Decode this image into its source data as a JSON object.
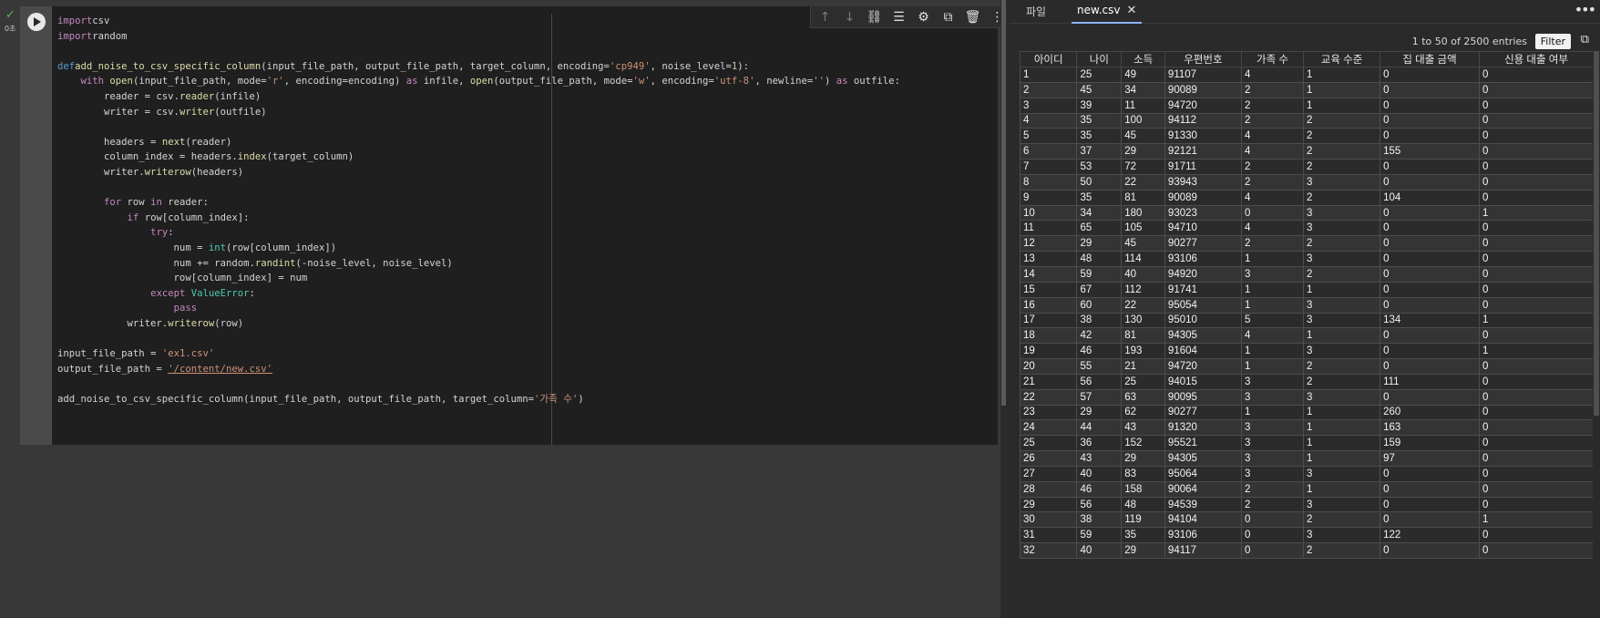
{
  "cell": {
    "exec_check": "✓",
    "exec_time": "0초",
    "code_lines": [
      [
        [
          "kw",
          "import"
        ],
        [
          "",
          "csv"
        ]
      ],
      [
        [
          "kw",
          "import"
        ],
        [
          "",
          "random"
        ]
      ],
      [],
      [
        [
          "df",
          "def"
        ],
        [
          "",
          ""
        ],
        [
          "fn",
          "add_noise_to_csv_specific_column"
        ],
        [
          "",
          "(input_file_path, output_file_path, target_column, encoding="
        ],
        [
          "st",
          "'cp949'"
        ],
        [
          "",
          ", noise_level="
        ],
        [
          "nm",
          "1"
        ],
        [
          "",
          "):"
        ]
      ],
      [
        [
          "",
          "    "
        ],
        [
          "kw",
          "with"
        ],
        [
          "",
          " "
        ],
        [
          "fn",
          "open"
        ],
        [
          "",
          "(input_file_path, mode="
        ],
        [
          "st",
          "'r'"
        ],
        [
          "",
          ", encoding=encoding) "
        ],
        [
          "kw",
          "as"
        ],
        [
          "",
          " infile, "
        ],
        [
          "fn",
          "open"
        ],
        [
          "",
          "(output_file_path, mode="
        ],
        [
          "st",
          "'w'"
        ],
        [
          "",
          ", encoding="
        ],
        [
          "st",
          "'utf-8'"
        ],
        [
          "",
          ", newline="
        ],
        [
          "st",
          "''"
        ],
        [
          "",
          ") "
        ],
        [
          "kw",
          "as"
        ],
        [
          "",
          " outfile:"
        ]
      ],
      [
        [
          "",
          "        reader = csv."
        ],
        [
          "fn",
          "reader"
        ],
        [
          "",
          "(infile)"
        ]
      ],
      [
        [
          "",
          "        writer = csv."
        ],
        [
          "fn",
          "writer"
        ],
        [
          "",
          "(outfile)"
        ]
      ],
      [],
      [
        [
          "",
          "        headers = "
        ],
        [
          "fn",
          "next"
        ],
        [
          "",
          "(reader)"
        ]
      ],
      [
        [
          "",
          "        column_index = headers."
        ],
        [
          "fn",
          "index"
        ],
        [
          "",
          "(target_column)"
        ]
      ],
      [
        [
          "",
          "        writer."
        ],
        [
          "fn",
          "writerow"
        ],
        [
          "",
          "(headers)"
        ]
      ],
      [],
      [
        [
          "",
          "        "
        ],
        [
          "kw",
          "for"
        ],
        [
          "",
          " row "
        ],
        [
          "kw",
          "in"
        ],
        [
          "",
          " reader:"
        ]
      ],
      [
        [
          "",
          "            "
        ],
        [
          "kw",
          "if"
        ],
        [
          "",
          " row[column_index]:"
        ]
      ],
      [
        [
          "",
          "                "
        ],
        [
          "kw",
          "try"
        ],
        [
          "",
          ":"
        ]
      ],
      [
        [
          "",
          "                    num = "
        ],
        [
          "bi",
          "int"
        ],
        [
          "",
          "(row[column_index])"
        ]
      ],
      [
        [
          "",
          "                    num += random."
        ],
        [
          "fn",
          "randint"
        ],
        [
          "",
          "(-noise_level, noise_level)"
        ]
      ],
      [
        [
          "",
          "                    row[column_index] = num"
        ]
      ],
      [
        [
          "",
          "                "
        ],
        [
          "kw",
          "except"
        ],
        [
          "",
          " "
        ],
        [
          "bi",
          "ValueError"
        ],
        [
          "",
          ":"
        ]
      ],
      [
        [
          "",
          "                    "
        ],
        [
          "kw",
          "pass"
        ]
      ],
      [
        [
          "",
          "            writer."
        ],
        [
          "fn",
          "writerow"
        ],
        [
          "",
          "(row)"
        ]
      ],
      [],
      [
        [
          "",
          "input_file_path = "
        ],
        [
          "st",
          "'ex1.csv'"
        ]
      ],
      [
        [
          "",
          "output_file_path = "
        ],
        [
          "st",
          "'/content/new.csv'"
        ]
      ],
      [],
      [
        [
          "",
          "add_noise_to_csv_specific_column(input_file_path, output_file_path, target_column="
        ],
        [
          "st",
          "'가족 수'"
        ],
        [
          "",
          ")"
        ]
      ]
    ]
  },
  "toolbar": {
    "icons": [
      {
        "name": "move-up-icon",
        "glyph": "↑",
        "dim": true
      },
      {
        "name": "move-down-icon",
        "glyph": "↓",
        "dim": true
      },
      {
        "name": "link-icon",
        "glyph": "⛓",
        "dim": false
      },
      {
        "name": "comment-icon",
        "glyph": "☰",
        "dim": false
      },
      {
        "name": "settings-gear-icon",
        "glyph": "⚙",
        "dim": false
      },
      {
        "name": "mirror-cell-icon",
        "glyph": "⧉",
        "dim": false
      },
      {
        "name": "delete-trash-icon",
        "glyph": "🗑",
        "dim": false
      },
      {
        "name": "more-vert-icon",
        "glyph": "⋮",
        "dim": false
      }
    ]
  },
  "viewer": {
    "tab_files": "파일",
    "tab_file_name": "new.csv",
    "tab_close_glyph": "✕",
    "more_glyph": "•••",
    "entries_text": "1 to 50 of 2500 entries",
    "filter_label": "Filter",
    "copy_glyph": "⧉",
    "columns": [
      "아이디",
      "나이",
      "소득",
      "우편번호",
      "가족 수",
      "교육 수준",
      "집 대출 금액",
      "신용 대출 여부"
    ],
    "rows": [
      [
        "1",
        "25",
        "49",
        "91107",
        "4",
        "1",
        "0",
        "0"
      ],
      [
        "2",
        "45",
        "34",
        "90089",
        "2",
        "1",
        "0",
        "0"
      ],
      [
        "3",
        "39",
        "11",
        "94720",
        "2",
        "1",
        "0",
        "0"
      ],
      [
        "4",
        "35",
        "100",
        "94112",
        "2",
        "2",
        "0",
        "0"
      ],
      [
        "5",
        "35",
        "45",
        "91330",
        "4",
        "2",
        "0",
        "0"
      ],
      [
        "6",
        "37",
        "29",
        "92121",
        "4",
        "2",
        "155",
        "0"
      ],
      [
        "7",
        "53",
        "72",
        "91711",
        "2",
        "2",
        "0",
        "0"
      ],
      [
        "8",
        "50",
        "22",
        "93943",
        "2",
        "3",
        "0",
        "0"
      ],
      [
        "9",
        "35",
        "81",
        "90089",
        "4",
        "2",
        "104",
        "0"
      ],
      [
        "10",
        "34",
        "180",
        "93023",
        "0",
        "3",
        "0",
        "1"
      ],
      [
        "11",
        "65",
        "105",
        "94710",
        "4",
        "3",
        "0",
        "0"
      ],
      [
        "12",
        "29",
        "45",
        "90277",
        "2",
        "2",
        "0",
        "0"
      ],
      [
        "13",
        "48",
        "114",
        "93106",
        "1",
        "3",
        "0",
        "0"
      ],
      [
        "14",
        "59",
        "40",
        "94920",
        "3",
        "2",
        "0",
        "0"
      ],
      [
        "15",
        "67",
        "112",
        "91741",
        "1",
        "1",
        "0",
        "0"
      ],
      [
        "16",
        "60",
        "22",
        "95054",
        "1",
        "3",
        "0",
        "0"
      ],
      [
        "17",
        "38",
        "130",
        "95010",
        "5",
        "3",
        "134",
        "1"
      ],
      [
        "18",
        "42",
        "81",
        "94305",
        "4",
        "1",
        "0",
        "0"
      ],
      [
        "19",
        "46",
        "193",
        "91604",
        "1",
        "3",
        "0",
        "1"
      ],
      [
        "20",
        "55",
        "21",
        "94720",
        "1",
        "2",
        "0",
        "0"
      ],
      [
        "21",
        "56",
        "25",
        "94015",
        "3",
        "2",
        "111",
        "0"
      ],
      [
        "22",
        "57",
        "63",
        "90095",
        "3",
        "3",
        "0",
        "0"
      ],
      [
        "23",
        "29",
        "62",
        "90277",
        "1",
        "1",
        "260",
        "0"
      ],
      [
        "24",
        "44",
        "43",
        "91320",
        "3",
        "1",
        "163",
        "0"
      ],
      [
        "25",
        "36",
        "152",
        "95521",
        "3",
        "1",
        "159",
        "0"
      ],
      [
        "26",
        "43",
        "29",
        "94305",
        "3",
        "1",
        "97",
        "0"
      ],
      [
        "27",
        "40",
        "83",
        "95064",
        "3",
        "3",
        "0",
        "0"
      ],
      [
        "28",
        "46",
        "158",
        "90064",
        "2",
        "1",
        "0",
        "0"
      ],
      [
        "29",
        "56",
        "48",
        "94539",
        "2",
        "3",
        "0",
        "0"
      ],
      [
        "30",
        "38",
        "119",
        "94104",
        "0",
        "2",
        "0",
        "1"
      ],
      [
        "31",
        "59",
        "35",
        "93106",
        "0",
        "3",
        "122",
        "0"
      ],
      [
        "32",
        "40",
        "29",
        "94117",
        "0",
        "2",
        "0",
        "0"
      ]
    ]
  }
}
